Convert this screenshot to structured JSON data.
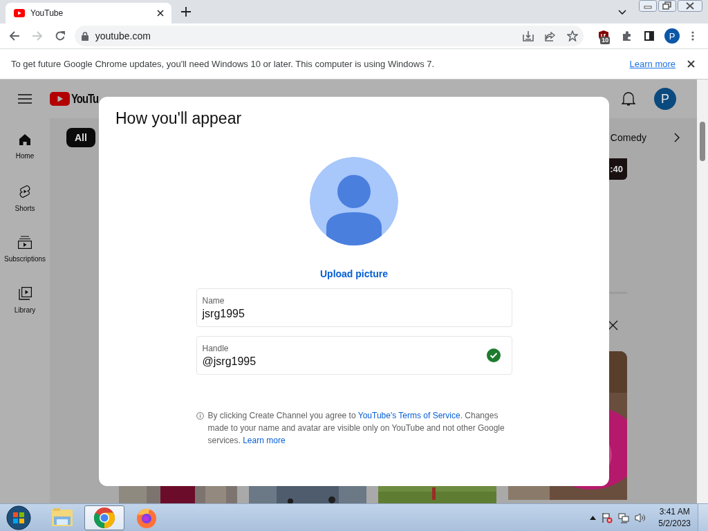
{
  "browser": {
    "tab": {
      "title": "YouTube",
      "selected": true
    },
    "address": "youtube.com",
    "forward_disabled": true,
    "extension_badge": "10",
    "profile_initial": "P"
  },
  "infobar": {
    "message": "To get future Google Chrome updates, you'll need Windows 10 or later. This computer is using Windows 7.",
    "link": "Learn more"
  },
  "youtube": {
    "logo_text": "YouTu",
    "avatar_initial": "P",
    "sidebar": [
      {
        "kind": "home",
        "label": "Home"
      },
      {
        "kind": "shorts",
        "label": "Shorts"
      },
      {
        "kind": "subscriptions",
        "label": "Subscriptions"
      },
      {
        "kind": "library",
        "label": "Library"
      }
    ],
    "chips": [
      {
        "label": "All",
        "selected": true
      },
      {
        "label": "Comedy",
        "selected": false
      }
    ],
    "duration": ":40"
  },
  "dialog": {
    "title": "How you'll appear",
    "upload": "Upload picture",
    "fields": [
      {
        "label": "Name",
        "value": "jsrg1995",
        "valid": false
      },
      {
        "label": "Handle",
        "value": "@jsrg1995",
        "valid": true
      }
    ],
    "notice": {
      "before": "By clicking Create Channel you agree to ",
      "terms_link": "YouTube's Terms of Service",
      "after": ". Changes made to your name and avatar are visible only on YouTube and not other Google services. ",
      "learn_link": "Learn more"
    }
  },
  "taskbar": {
    "apps": [
      {
        "kind": "explorer",
        "selected": false
      },
      {
        "kind": "chrome",
        "selected": true
      },
      {
        "kind": "firefox",
        "selected": false
      }
    ],
    "time": "3:41 AM",
    "date": "5/2/2023"
  }
}
